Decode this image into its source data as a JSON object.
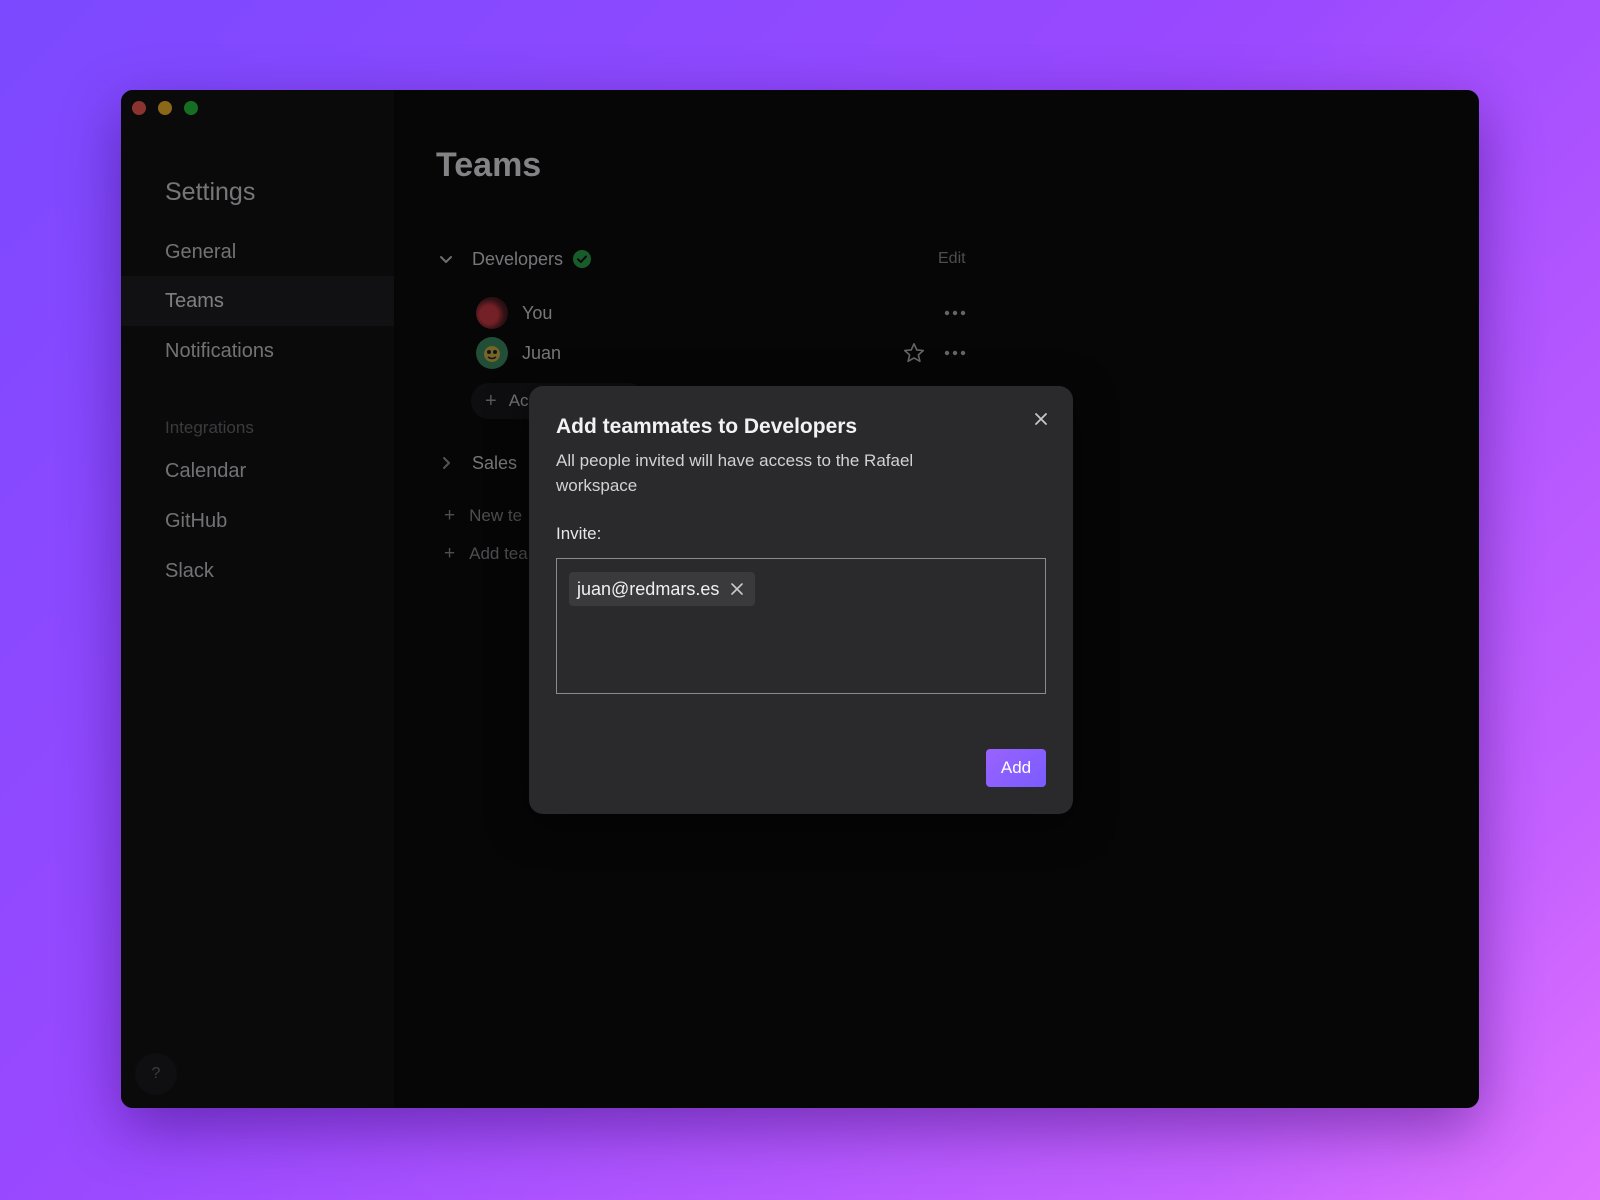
{
  "window": {
    "controls": {
      "close_icon": "close-window-dot",
      "minimize_icon": "minimize-window-dot",
      "zoom_icon": "zoom-window-dot"
    }
  },
  "sidebar": {
    "title": "Settings",
    "items": [
      {
        "label": "General",
        "active": false
      },
      {
        "label": "Teams",
        "active": true
      },
      {
        "label": "Notifications",
        "active": false
      }
    ],
    "integrations_label": "Integrations",
    "integrations": [
      {
        "label": "Calendar"
      },
      {
        "label": "GitHub"
      },
      {
        "label": "Slack"
      }
    ],
    "help_label": "?"
  },
  "main": {
    "title": "Teams",
    "teams": [
      {
        "name": "Developers",
        "expanded": true,
        "verified": true,
        "edit_label": "Edit",
        "members": [
          {
            "name": "You",
            "avatar": "avatar-you"
          },
          {
            "name": "Juan",
            "avatar": "avatar-juan"
          }
        ],
        "add_member_label": "Ac"
      },
      {
        "name": "Sales",
        "expanded": false
      }
    ],
    "new_team_label": "New te",
    "add_team_label": "Add tea"
  },
  "modal": {
    "title": "Add teammates to Developers",
    "subtitle": "All people invited will have access to the Rafael workspace",
    "invite_label": "Invite:",
    "invitees": [
      "juan@redmars.es"
    ],
    "add_button_label": "Add"
  },
  "colors": {
    "background_gradient": [
      "#7b49ff",
      "#e072ff"
    ],
    "accent": "#8a5cff",
    "verified_green": "#2fa84f",
    "window_bg": "#0b0b0d",
    "modal_bg": "#2a2a2c"
  }
}
